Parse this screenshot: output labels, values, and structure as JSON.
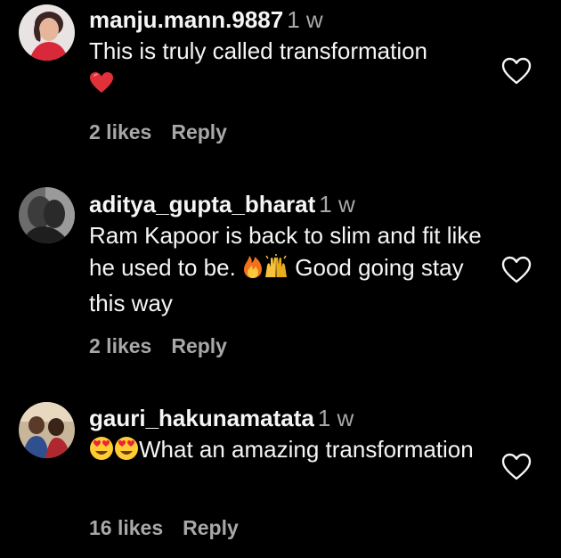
{
  "comments": [
    {
      "username": "manju.mann.9887",
      "time": "1 w",
      "text": "This is truly called transformation",
      "likes": "2 likes",
      "reply": "Reply",
      "emoji_after": "red-heart"
    },
    {
      "username": "aditya_gupta_bharat",
      "time": "1 w",
      "text_part1": "Ram Kapoor is back to slim and fit like he used to be. ",
      "text_part2": " Good going stay this way",
      "likes": "2 likes",
      "reply": "Reply",
      "emoji_inline": [
        "fire",
        "raising-hands"
      ]
    },
    {
      "username": "gauri_hakunamatata",
      "time": "1 w",
      "text": "What an amazing transformation",
      "likes": "16 likes",
      "reply": "Reply",
      "emoji_before": [
        "heart-eyes",
        "heart-eyes"
      ]
    }
  ],
  "colors": {
    "background": "#000000",
    "primary_text": "#f5f5f5",
    "secondary_text": "#a8a8a8",
    "heart_emoji": "#e0303a"
  },
  "icons": {
    "like": "heart-outline-icon"
  }
}
